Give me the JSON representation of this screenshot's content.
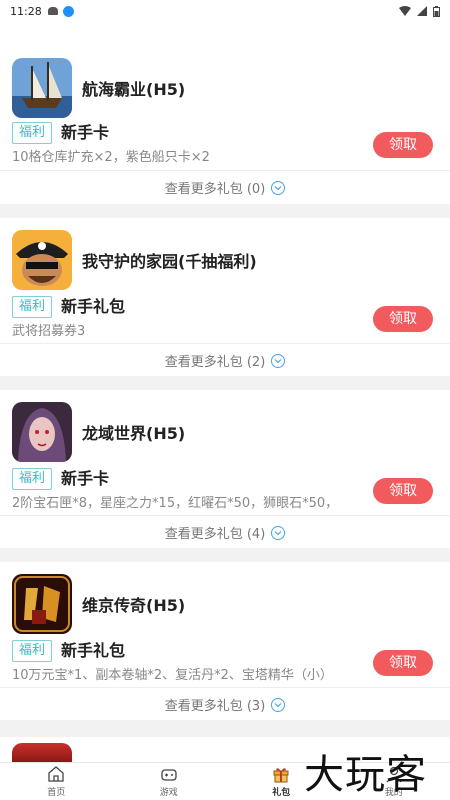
{
  "status_bar": {
    "time": "11:28"
  },
  "cards": [
    {
      "title": "航海霸业(H5)",
      "tag": "福利",
      "gift": "新手卡",
      "desc": "10格仓库扩充×2，紫色船只卡×2",
      "button": "领取",
      "more": "查看更多礼包 (0)",
      "icon": "ship-game-icon"
    },
    {
      "title": "我守护的家园(千抽福利)",
      "tag": "福利",
      "gift": "新手礼包",
      "desc": "武将招募券3",
      "button": "领取",
      "more": "查看更多礼包 (2)",
      "icon": "pirate-game-icon"
    },
    {
      "title": "龙域世界(H5)",
      "tag": "福利",
      "gift": "新手卡",
      "desc": "2阶宝石匣*8，星座之力*15，红曜石*50，狮眼石*50，",
      "button": "领取",
      "more": "查看更多礼包 (4)",
      "icon": "dragon-game-icon"
    },
    {
      "title": "维京传奇(H5)",
      "tag": "福利",
      "gift": "新手礼包",
      "desc": "10万元宝*1、副本卷轴*2、复活丹*2、宝塔精华（小）",
      "button": "领取",
      "more": "查看更多礼包 (3)",
      "icon": "legend-game-icon"
    }
  ],
  "nav": {
    "home": "首页",
    "games": "游戏",
    "gifts": "礼包",
    "mine": "我的"
  },
  "watermark": "大玩客"
}
